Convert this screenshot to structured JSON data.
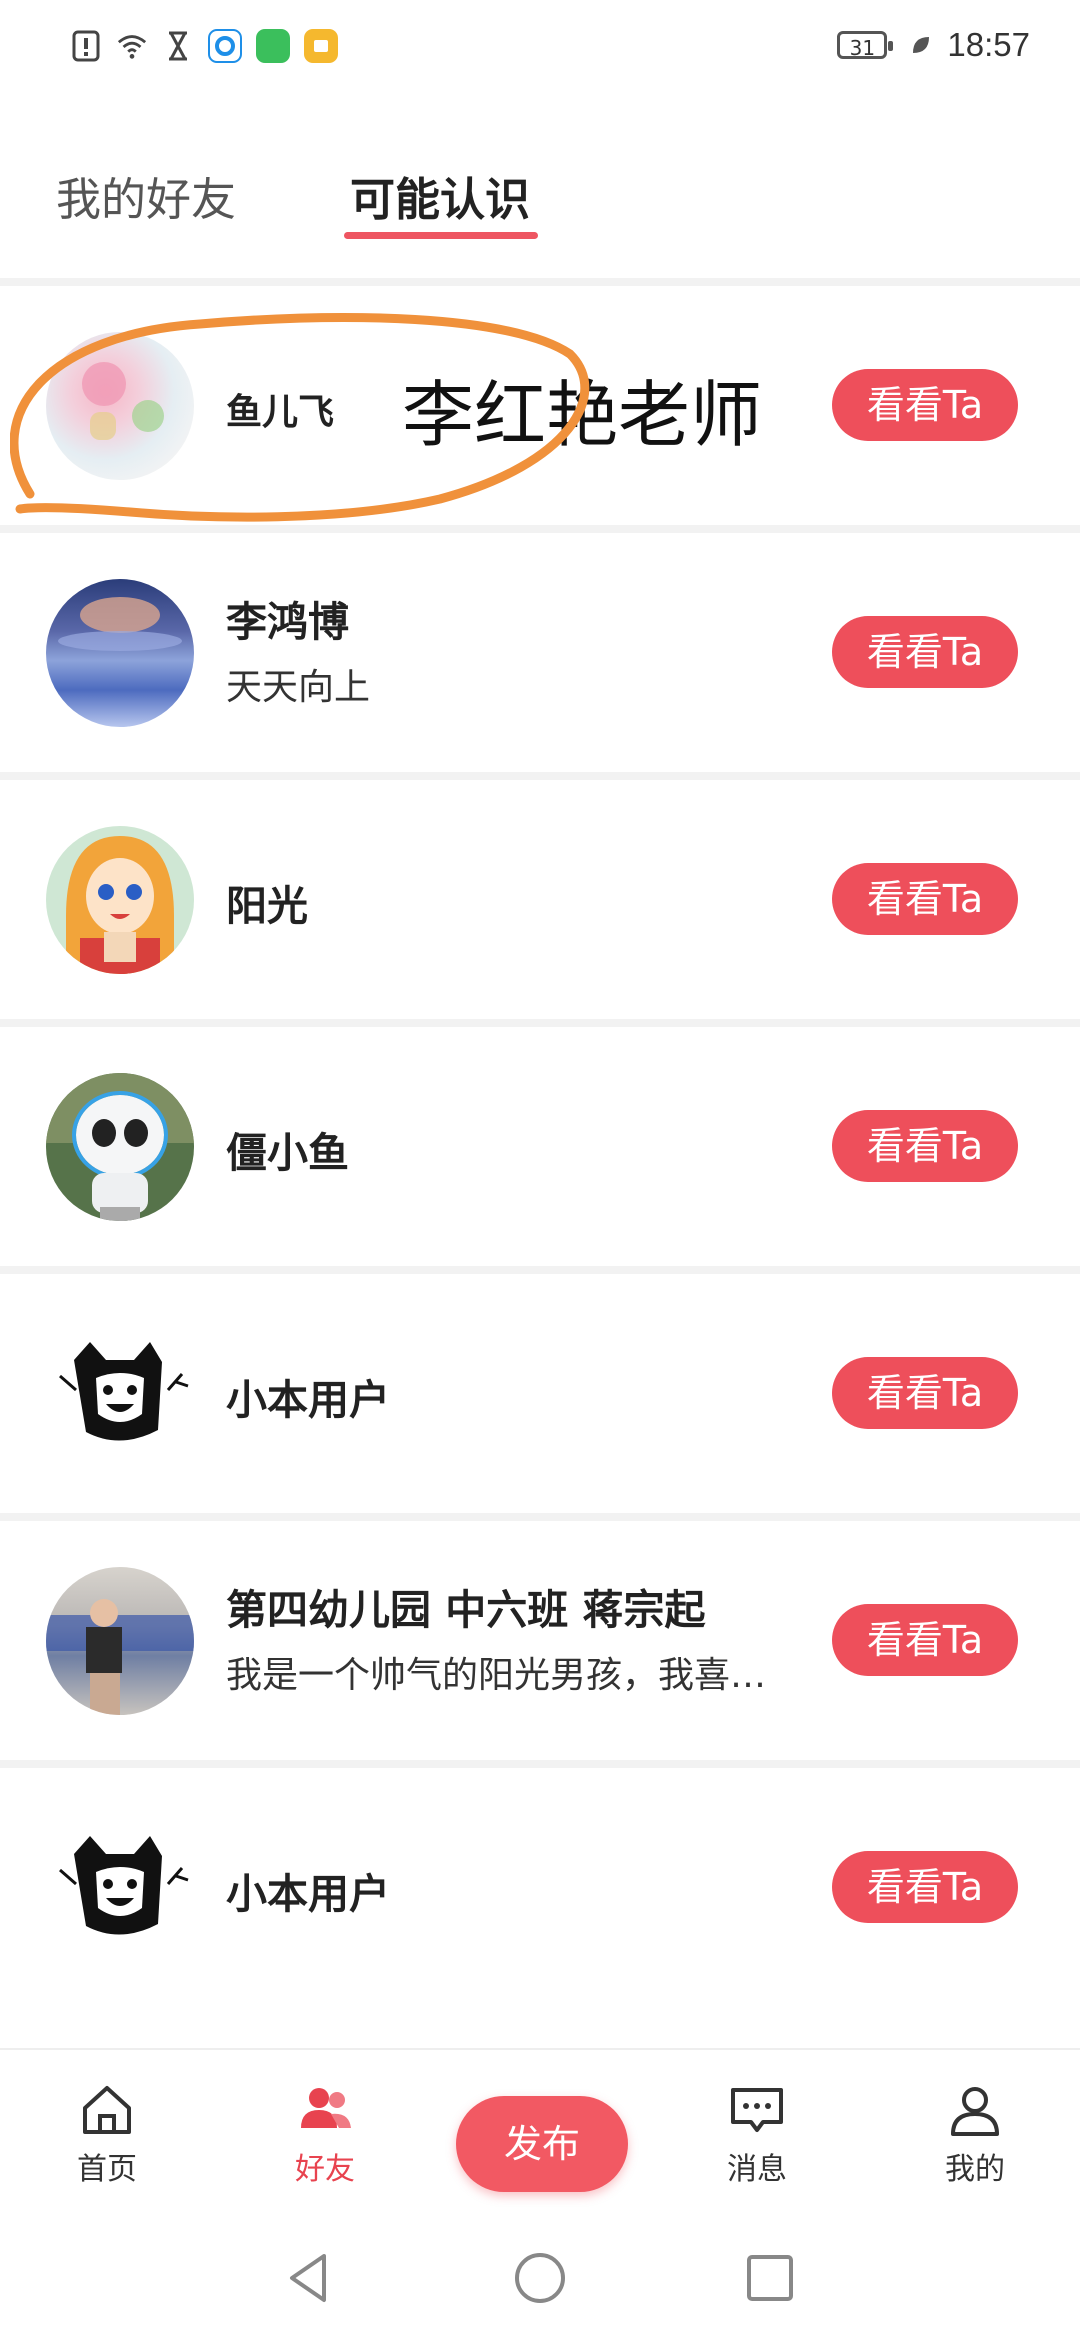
{
  "status_bar": {
    "icons": [
      "alert-icon",
      "wifi-icon",
      "hourglass-icon",
      "browser-app-icon",
      "kandian-app-icon",
      "notes-app-icon"
    ],
    "battery": "31",
    "time": "18:57"
  },
  "tabs": [
    {
      "label": "我的好友",
      "active": false
    },
    {
      "label": "可能认识",
      "active": true
    }
  ],
  "annotation_text": "李红艳老师",
  "people": [
    {
      "name": "鱼儿飞",
      "sub": "",
      "button": "看看Ta"
    },
    {
      "name": "李鸿博",
      "sub": "天天向上",
      "button": "看看Ta"
    },
    {
      "name": "阳光",
      "sub": "",
      "button": "看看Ta"
    },
    {
      "name": "僵小鱼",
      "sub": "",
      "button": "看看Ta"
    },
    {
      "name": "小本用户",
      "sub": "",
      "button": "看看Ta"
    },
    {
      "name": "第四幼儿园 中六班 蒋宗起",
      "sub": "我是一个帅气的阳光男孩，我喜…",
      "button": "看看Ta"
    },
    {
      "name": "小本用户",
      "sub": "",
      "button": "看看Ta"
    }
  ],
  "bottom_nav": {
    "home": "首页",
    "friends": "好友",
    "publish": "发布",
    "messages": "消息",
    "mine": "我的"
  },
  "colors": {
    "accent": "#ee4f5b",
    "tab_underline": "#ee5561",
    "annotation": "#f0913b"
  }
}
